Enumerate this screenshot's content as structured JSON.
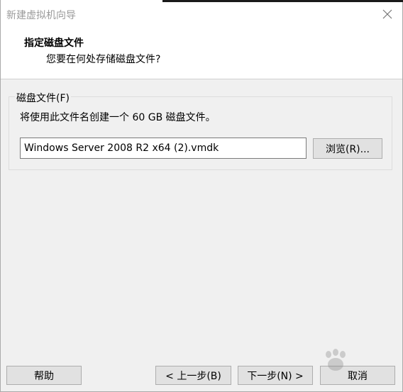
{
  "window": {
    "title": "新建虚拟机向导"
  },
  "header": {
    "title": "指定磁盘文件",
    "subtitle": "您要在何处存储磁盘文件?"
  },
  "group": {
    "label": "磁盘文件(F)",
    "description": "将使用此文件名创建一个 60 GB 磁盘文件。",
    "path_value": "Windows Server 2008 R2 x64 (2).vmdk",
    "browse_label": "浏览(R)..."
  },
  "footer": {
    "help_label": "帮助",
    "back_label": "< 上一步(B)",
    "next_label": "下一步(N) >",
    "cancel_label": "取消"
  },
  "watermark": {
    "icon": "baidu-paw-icon"
  }
}
